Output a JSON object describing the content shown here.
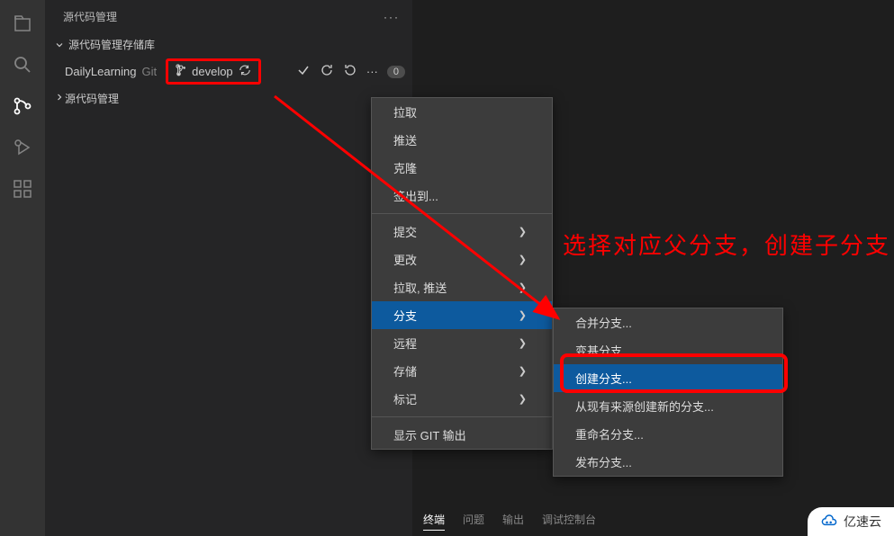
{
  "sidebar": {
    "title": "源代码管理",
    "section1_title": "源代码管理存储库",
    "section2_title": "源代码管理",
    "repo": {
      "name": "DailyLearning",
      "type": "Git",
      "branch": "develop",
      "count": "0"
    }
  },
  "menu1": {
    "pull": "拉取",
    "push": "推送",
    "clone": "克隆",
    "checkout": "签出到...",
    "commit": "提交",
    "changes": "更改",
    "pullpush": "拉取, 推送",
    "branch": "分支",
    "remote": "远程",
    "stash": "存储",
    "tag": "标记",
    "showgit": "显示 GIT 输出"
  },
  "menu2": {
    "merge": "合并分支...",
    "rebase": "变基分支...",
    "create": "创建分支...",
    "createfrom": "从现有来源创建新的分支...",
    "rename": "重命名分支...",
    "publish": "发布分支..."
  },
  "annotation": "选择对应父分支，创建子分支",
  "bottom_tabs": {
    "terminal": "终端",
    "problems": "问题",
    "output": "输出",
    "debug": "调试控制台"
  },
  "watermark": "亿速云"
}
